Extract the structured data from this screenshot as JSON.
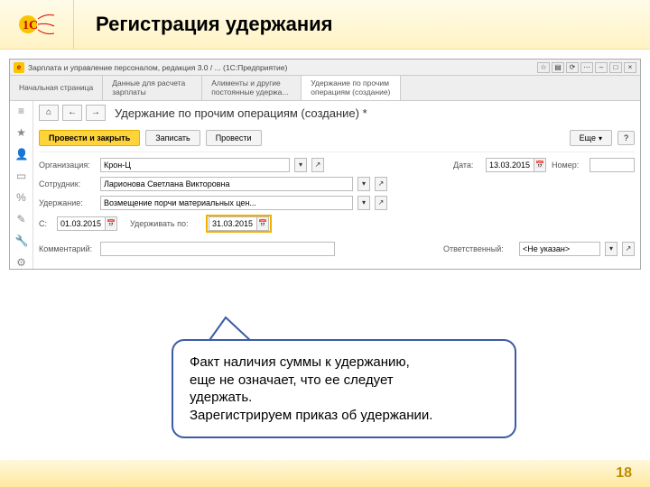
{
  "slide": {
    "title": "Регистрация удержания",
    "page_number": "18"
  },
  "window": {
    "title": "Зарплата и управление персоналом, редакция 3.0 / ... (1С:Предприятие)"
  },
  "section_tabs": [
    "Начальная страница",
    "Данные для расчета зарплаты",
    "Алименты и другие постоянные удержа...",
    "Удержание по прочим операциям (создание)"
  ],
  "nav": {
    "home": "⌂",
    "back": "←",
    "fwd": "→",
    "page_title": "Удержание по прочим операциям (создание) *"
  },
  "toolbar": {
    "post_close": "Провести и закрыть",
    "write": "Записать",
    "post": "Провести",
    "more": "Еще",
    "help": "?"
  },
  "form": {
    "org_label": "Организация:",
    "org_value": "Крон-Ц",
    "date_label": "Дата:",
    "date_value": "13.03.2015",
    "number_label": "Номер:",
    "number_value": "",
    "emp_label": "Сотрудник:",
    "emp_value": "Ларионова Светлана Викторовна",
    "hold_label": "Удержание:",
    "hold_value": "Возмещение порчи материальных цен...",
    "from_label": "С:",
    "from_value": "01.03.2015",
    "to_label": "Удерживать по:",
    "to_value": "31.03.2015",
    "comment_label": "Комментарий:",
    "resp_label": "Ответственный:",
    "resp_value": "<Не указан>"
  },
  "callout": {
    "line1": "Факт наличия суммы к удержанию,",
    "line2": "еще не означает, что ее следует",
    "line3": "удержать.",
    "line4": "Зарегистрируем приказ об удержании."
  }
}
